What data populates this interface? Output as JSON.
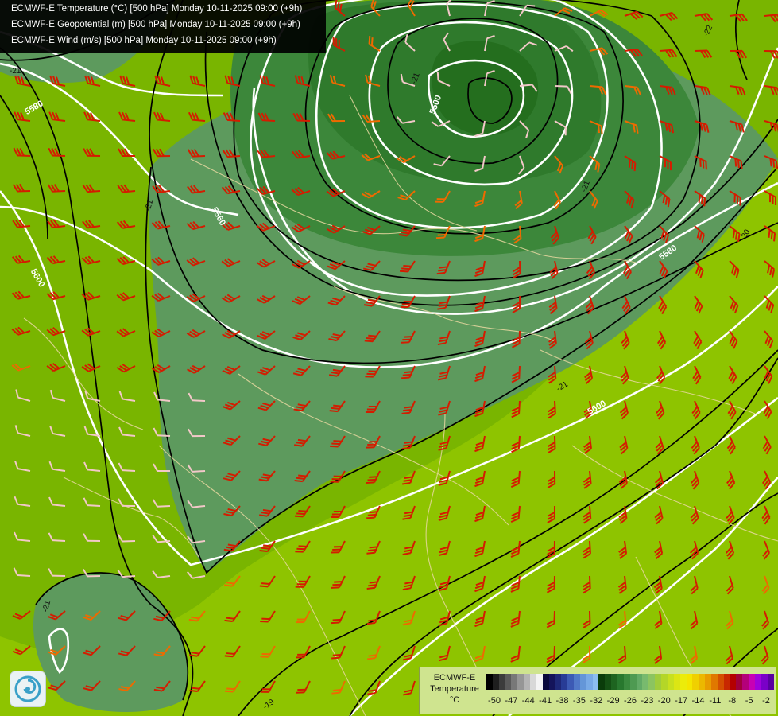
{
  "title_lines": [
    "ECMWF-E Temperature (°C) [500 hPa] Monday 10-11-2025 09:00 (+9h)",
    "ECMWF-E Geopotential (m) [500 hPa] Monday 10-11-2025 09:00 (+9h)",
    "ECMWF-E Wind (m/s) [500 hPa] Monday 10-11-2025 09:00 (+9h)"
  ],
  "geopotential_labels": [
    "5500",
    "5560",
    "5580",
    "5600",
    "5580",
    "5600"
  ],
  "temperature_labels": [
    "-21",
    "-21",
    "-21",
    "-22",
    "-20",
    "-21",
    "-21",
    "-19",
    "-21"
  ],
  "legend": {
    "line1": "ECMWF-E",
    "line2": "Temperature",
    "line3": "°C",
    "ticks": [
      "-50",
      "-47",
      "-44",
      "-41",
      "-38",
      "-35",
      "-32",
      "-29",
      "-26",
      "-23",
      "-20",
      "-17",
      "-14",
      "-11",
      "-8",
      "-5",
      "-2"
    ],
    "colors": [
      "#000000",
      "#1e1e1e",
      "#3c3c3c",
      "#5a5a5a",
      "#787878",
      "#969696",
      "#b4b4b4",
      "#d8d8d8",
      "#f4f4f4",
      "#0a0a3c",
      "#14145a",
      "#1e2878",
      "#283c96",
      "#3c5ab4",
      "#5078c8",
      "#6496d8",
      "#78aae6",
      "#8cbef0",
      "#0a3c0a",
      "#145014",
      "#1e6420",
      "#28782e",
      "#3a8a3e",
      "#4e9a52",
      "#62aa66",
      "#78ba6e",
      "#8cc460",
      "#a0cc3c",
      "#b4d628",
      "#c8e01e",
      "#dce614",
      "#ecec0a",
      "#f4e600",
      "#f0d000",
      "#ecb800",
      "#e89c00",
      "#e07800",
      "#d45000",
      "#c82800",
      "#b40000",
      "#a0003c",
      "#b4007a",
      "#c800b4",
      "#a000dc",
      "#7a00c8",
      "#5a00a0"
    ]
  },
  "colors": {
    "cold_core": "#246e1e",
    "cold_ring1": "#2f7a2c",
    "cold_ring2": "#3c873a",
    "trough": "#4f8f55",
    "trough_light": "#5d9a5d",
    "warm_green": "#79b500",
    "warmer_green": "#8ec400",
    "geopotential_line": "#ffffff",
    "temperature_line": "#000000",
    "barb_red": "#d41c00",
    "barb_orange": "#ee6a00",
    "barb_pink": "#f2c8c8",
    "border_line": "#e8d8a0"
  }
}
